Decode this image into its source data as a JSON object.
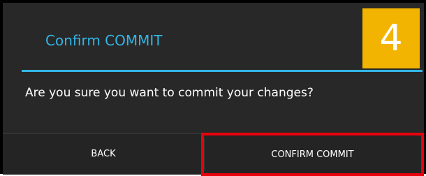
{
  "dialog": {
    "title": "Confirm COMMIT",
    "message": "Are you sure you want to commit your changes?",
    "buttons": {
      "back_label": "BACK",
      "confirm_label": "CONFIRM COMMIT"
    }
  },
  "annotation": {
    "step_number": "4",
    "highlight_color": "#e8000b",
    "badge_color": "#f2b400"
  },
  "theme": {
    "accent": "#33b5e5",
    "background": "#282828"
  }
}
